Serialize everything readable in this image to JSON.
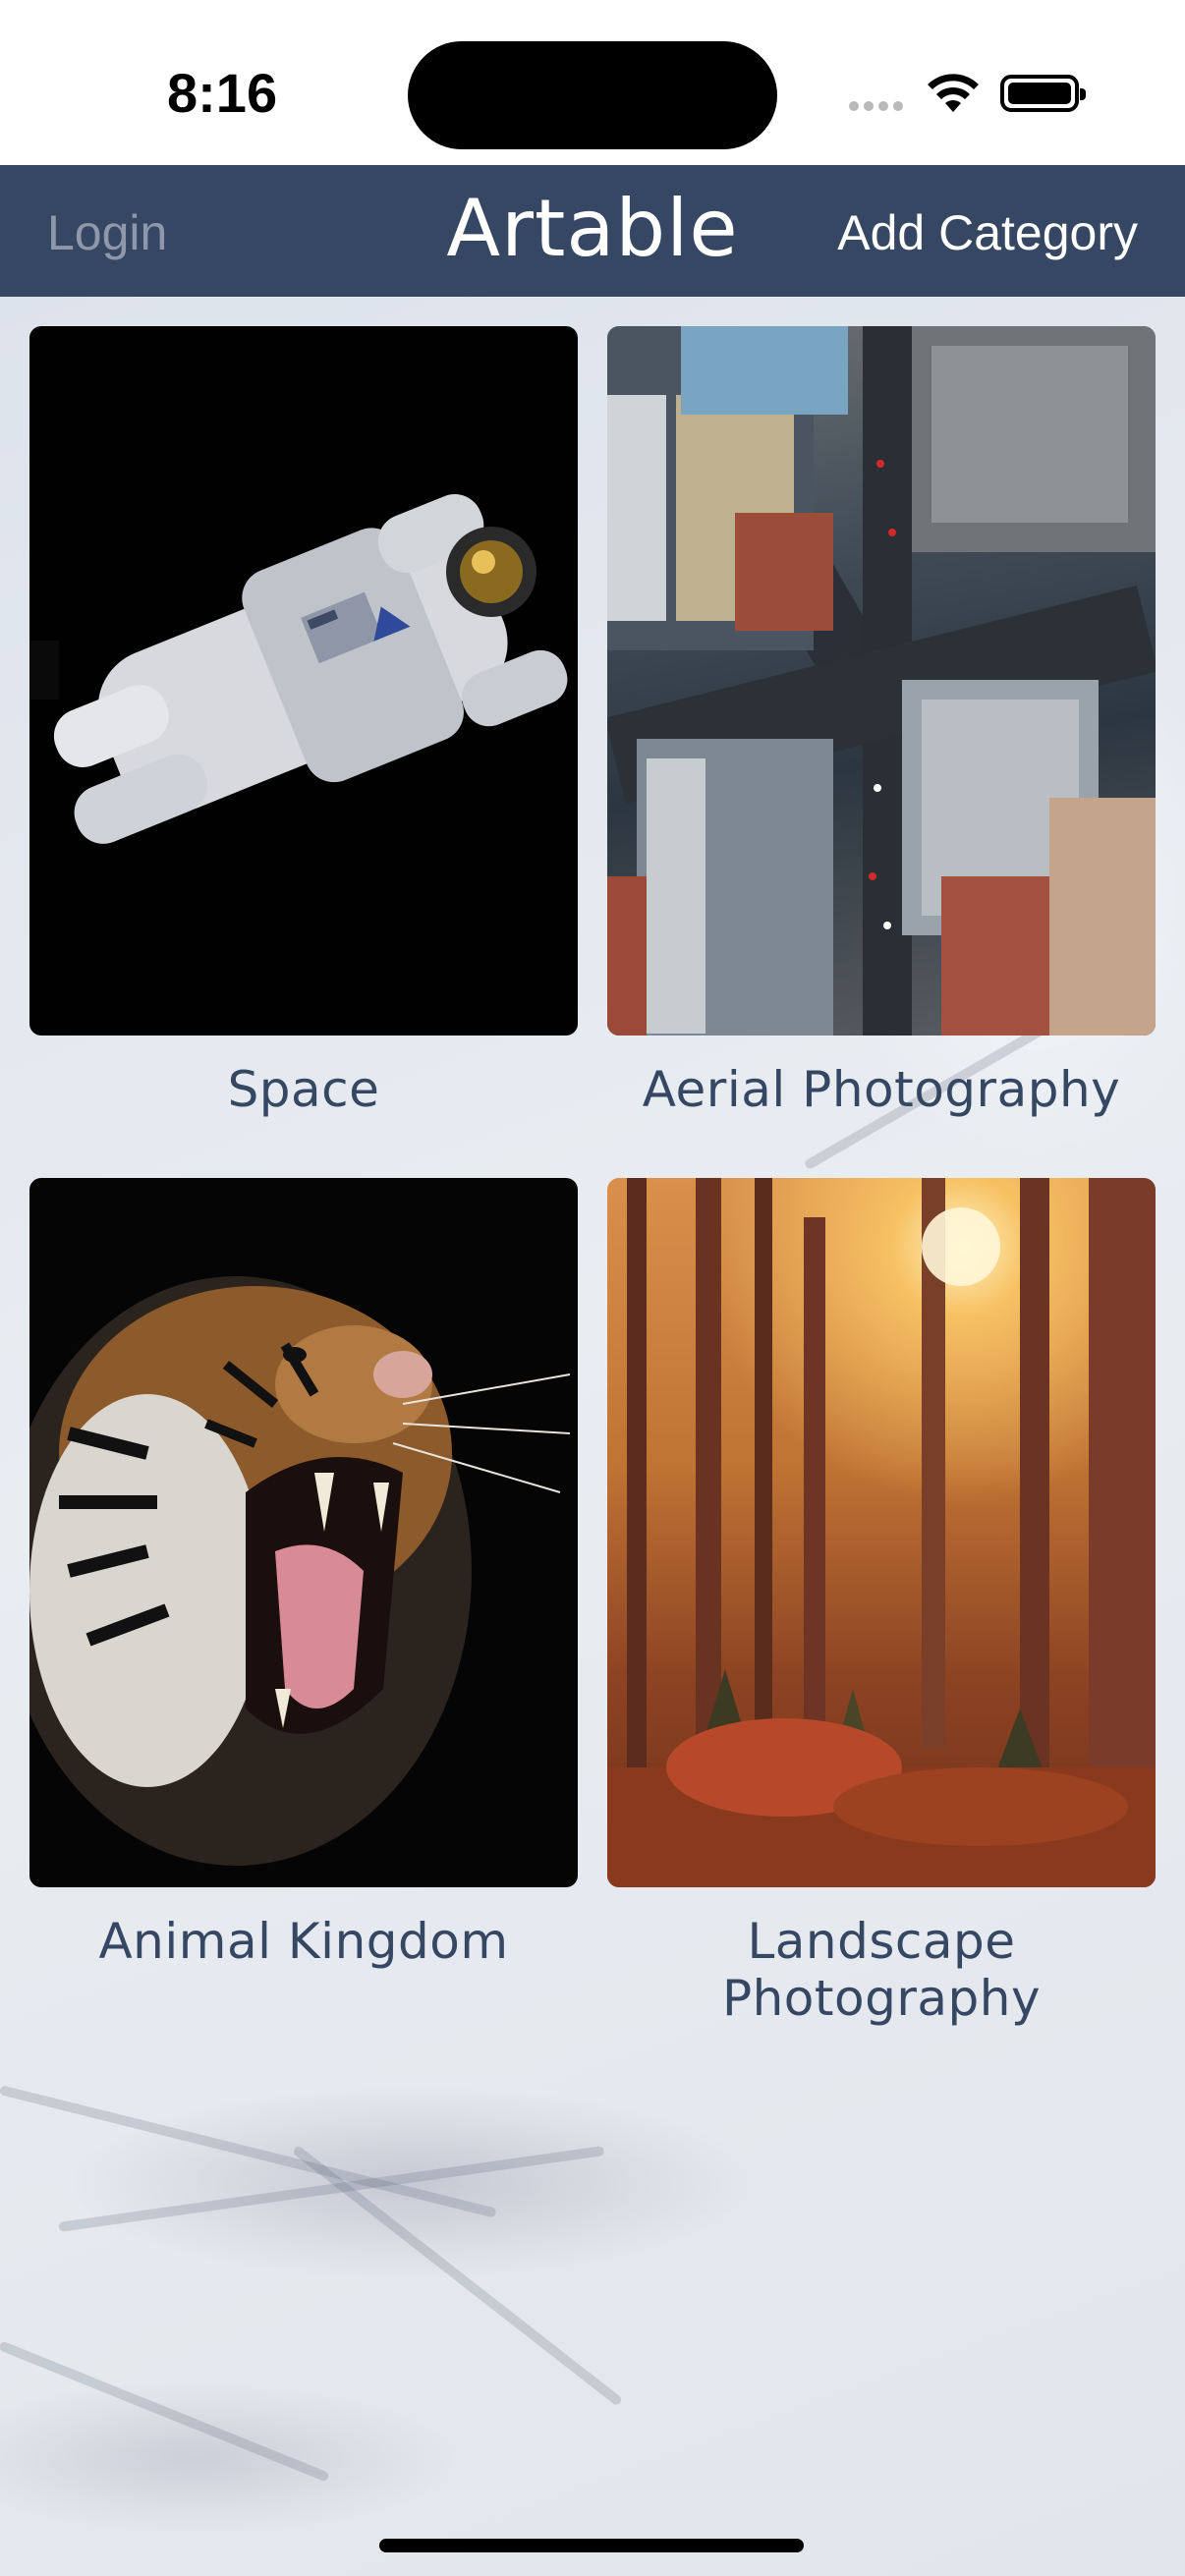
{
  "status_bar": {
    "time": "8:16"
  },
  "nav": {
    "login_label": "Login",
    "title": "Artable",
    "add_label": "Add Category"
  },
  "categories": [
    {
      "label": "Space",
      "image": "astronaut floating on black background"
    },
    {
      "label": "Aerial Photography",
      "image": "overhead view of city buildings and street"
    },
    {
      "label": "Animal Kingdom",
      "image": "roaring tiger on black background"
    },
    {
      "label": "Landscape Photography",
      "image": "sunlit autumn forest"
    }
  ],
  "colors": {
    "nav_background": "#364763",
    "label_text": "#364763",
    "login_text": "#8e98aa"
  }
}
